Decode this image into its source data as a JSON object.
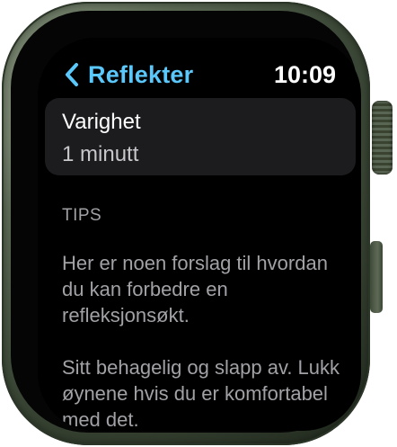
{
  "header": {
    "back_label": "Reflekter",
    "time": "10:09"
  },
  "duration_setting": {
    "title": "Varighet",
    "value": "1 minutt"
  },
  "tips": {
    "header": "TIPS",
    "paragraphs": [
      "Her er noen forslag til hvordan du kan forbedre en refleksjonsøkt.",
      "Sitt behagelig og slapp av. Lukk øynene hvis du er komfortabel med det."
    ]
  },
  "colors": {
    "accent": "#5ac8fa",
    "card_background": "#1c1c1e",
    "secondary_text": "#a1a1a6",
    "case_color": "#4f5e48"
  },
  "icons": {
    "back": "chevron-left-icon"
  }
}
